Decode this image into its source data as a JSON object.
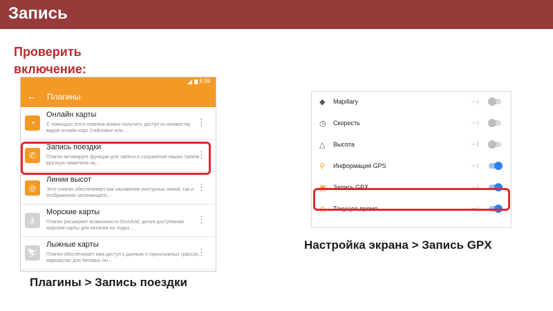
{
  "slide": {
    "title": "Запись",
    "check_label": "Проверить включение:",
    "caption_left": "Плагины > Запись поездки",
    "caption_right": "Настройка экрана > Запись GPX"
  },
  "plugins_screen": {
    "status_time": "8:59",
    "title": "Плагины",
    "plugins": [
      {
        "name": "Онлайн карты",
        "description": "С помощью этого плагина можно получить доступ ко множеству видов онлайн-карт (тайловых или...",
        "enabled": true
      },
      {
        "name": "Запись поездки",
        "description": "Плагин активирует функции для записи и сохранения ваших треков вручную нажатием на...",
        "enabled": true
      },
      {
        "name": "Линии высот",
        "description": "Этот плагин обеспечивает как наложение контурных линий, так и отображения затеняющего...",
        "enabled": true
      },
      {
        "name": "Морские карты",
        "description": "Плагин расширяет возможности OsmAnd, делая доступными морские карты для катания на лодка...",
        "enabled": false
      },
      {
        "name": "Лыжные карты",
        "description": "Плагин обеспечивает вам доступ к данным о горнолыжных трассах, маршрутах для беговых лы...",
        "enabled": false
      }
    ]
  },
  "widgets_screen": {
    "dash": "—|",
    "widgets": [
      {
        "name": "Mapillary",
        "icon": "mapillary-icon",
        "on": false
      },
      {
        "name": "Скорость",
        "icon": "speed-icon",
        "on": false
      },
      {
        "name": "Высота",
        "icon": "altitude-icon",
        "on": false
      },
      {
        "name": "Информация GPS",
        "icon": "gps-info-icon",
        "on": true
      },
      {
        "name": "Запись GPX",
        "icon": "gpx-record-icon",
        "on": true
      },
      {
        "name": "Текущее время",
        "icon": "clock-icon",
        "on": true
      }
    ]
  },
  "colors": {
    "title_bar": "#963a3a",
    "accent_orange": "#f39a26",
    "highlight_red": "#e4262d",
    "toggle_blue": "#2f80ed"
  }
}
